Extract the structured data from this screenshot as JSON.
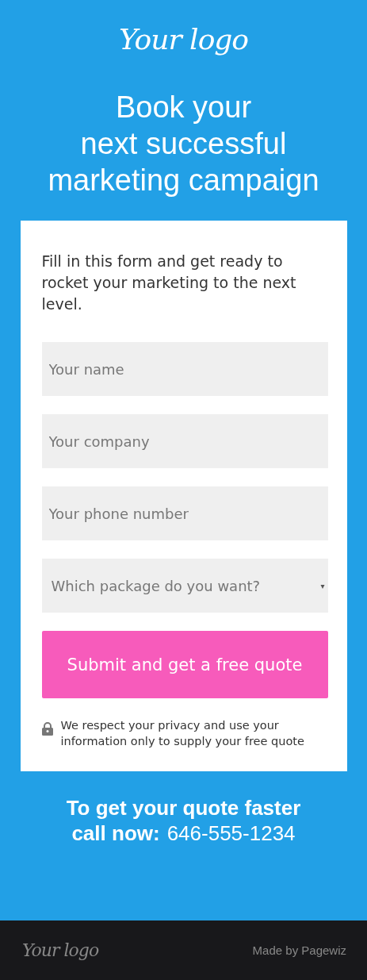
{
  "header": {
    "logo": "Your logo"
  },
  "headline": [
    "Book your",
    "next successful",
    "marketing campaign"
  ],
  "form": {
    "intro": "Fill in this form and get ready to rocket your marketing to the next level.",
    "fields": [
      {
        "kind": "text",
        "placeholder": "Your name"
      },
      {
        "kind": "text",
        "placeholder": "Your company"
      },
      {
        "kind": "text",
        "placeholder": "Your phone number"
      },
      {
        "kind": "select",
        "placeholder": "Which package do you want?",
        "caret": "▾"
      }
    ],
    "submit": "Submit and get a free quote",
    "privacy": "We respect your privacy and use your information only to supply your free quote"
  },
  "call": {
    "line": "To get your quote faster",
    "label": "call now:",
    "phone": "646-555-1234"
  },
  "footer": {
    "logo": "Your logo",
    "credit": "Made by Pagewiz"
  }
}
